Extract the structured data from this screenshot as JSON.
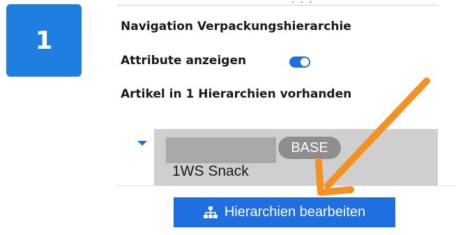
{
  "step": {
    "number": "1"
  },
  "panel": {
    "top_fragment": "· · ·",
    "heading_navigation": "Navigation Verpackungshierarchie",
    "heading_attributes": "Attribute anzeigen",
    "attributes_toggle_on": true,
    "heading_articles": "Artikel in 1 Hierarchien vorhanden"
  },
  "tree": {
    "node": {
      "badge": "BASE",
      "name": "1WS Snack"
    }
  },
  "actions": {
    "edit_hierarchies_label": "Hierarchien bearbeiten",
    "edit_hierarchies_icon": "sitemap-icon"
  },
  "colors": {
    "accent": "#1f6fe0",
    "annotation_arrow": "#f39222",
    "badge_bg": "#8e8e8e"
  }
}
